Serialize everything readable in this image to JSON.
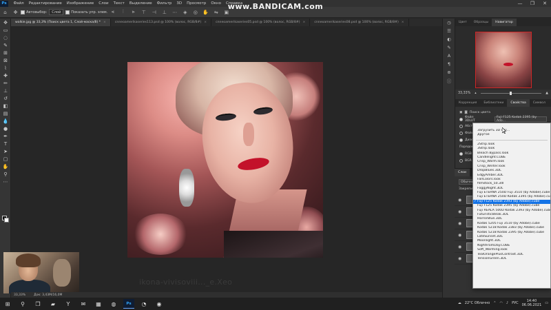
{
  "app": {
    "logo": "Ps",
    "menu": [
      "Файл",
      "Редактирование",
      "Изображение",
      "Слои",
      "Текст",
      "Выделение",
      "Фильтр",
      "3D",
      "Просмотр",
      "Окно",
      "Справка"
    ],
    "window_controls": [
      "—",
      "❐",
      "✕"
    ]
  },
  "options_bar": {
    "auto_select_label": "Автовыбор:",
    "auto_select_value": "Слой",
    "show_controls_label": "Показать упр. элем."
  },
  "recorder_watermark": "www.BANDICAM.com",
  "tabs": [
    {
      "label": "walkie.jpg @ 33,3% (Поиск цвета 1, Слой-маска/8) *",
      "active": true
    },
    {
      "label": "cnneoamerikaseries113.psd @ 100% (волос, RGB/8#)",
      "active": false
    },
    {
      "label": "cnneoamerikaseries05.psd @ 100% (волос, RGB/8#)",
      "active": false
    },
    {
      "label": "cnneoamerikaseries08.psd @ 100% (волос, RGB/8#)",
      "active": false
    }
  ],
  "canvas": {
    "watermark_text": "ikona-vivisoviii..._e.Хeo"
  },
  "status_bar": {
    "zoom": "33,33%",
    "doc": "Док: 3,43M/16,0M"
  },
  "right_panel": {
    "top_tabs": [
      "Цвет",
      "Образцы",
      "Навигатор"
    ],
    "zoom_value": "33,33%",
    "mid_tabs": [
      "Коррекция",
      "Библиотеки",
      "Свойства",
      "Символ"
    ],
    "props_title": "Поиск цвета",
    "file_3dlut_label": "Файл 3DLUT",
    "file_3dlut_value": "Fuji F125 Kodak 2395 (by Ado...",
    "abstract_label": "Абстрак",
    "devicelink_label": "Файл Devi...",
    "dither_label": "Дизеринг",
    "order_label": "Порядок",
    "rgb_label": "RGB",
    "bgr_label": "BGR",
    "layers_tab_1": "Слои",
    "layers_tab_2": "Каналы",
    "layers_kind": "Обычные",
    "layers_lock": "Закрепить"
  },
  "dropdown": {
    "top_items": [
      "Загрузить 3D LUT...",
      "Другое"
    ],
    "items": [
      "2Strip.look",
      "3Strip.look",
      "Bleach Bypass.look",
      "Candlelight.CUBE",
      "Crisp_Warm.look",
      "Crisp_Winter.look",
      "DropBlues.3DL",
      "EdgyAmber.3DL",
      "FallColors.look",
      "filmstock_50.3dl",
      "FoggyNight.3DL",
      "Fuji ETERNA 250D Fuji 3510 (by Adobe).cube",
      "Fuji ETERNA 250D Kodak 2395 (by Adobe).cube",
      "Fuji F125 Kodak 2393 (by Adobe).cube",
      "Fuji F125 Kodak 2395 (by Adobe).cube",
      "Fuji REALA 500D Kodak 2393 (by Adobe).cube",
      "FuturisticBleak.3DL",
      "HorrorBlue.3DL",
      "Kodak 5205 Fuji 3510 (by Adobe).cube",
      "Kodak 5218 Kodak 2383 (by Adobe).cube",
      "Kodak 5218 Kodak 2395 (by Adobe).cube",
      "LateSunset.3DL",
      "Moonlight.3DL",
      "NightFromDay.CUBE",
      "Soft_Warming.look",
      "TealOrangePlusContrast.3DL",
      "TensionGreen.3DL"
    ],
    "selected_index": 13
  },
  "taskbar": {
    "weather": "22°C Облачно",
    "lang": "РУС",
    "time": "14:40",
    "date": "06.06.2021"
  }
}
